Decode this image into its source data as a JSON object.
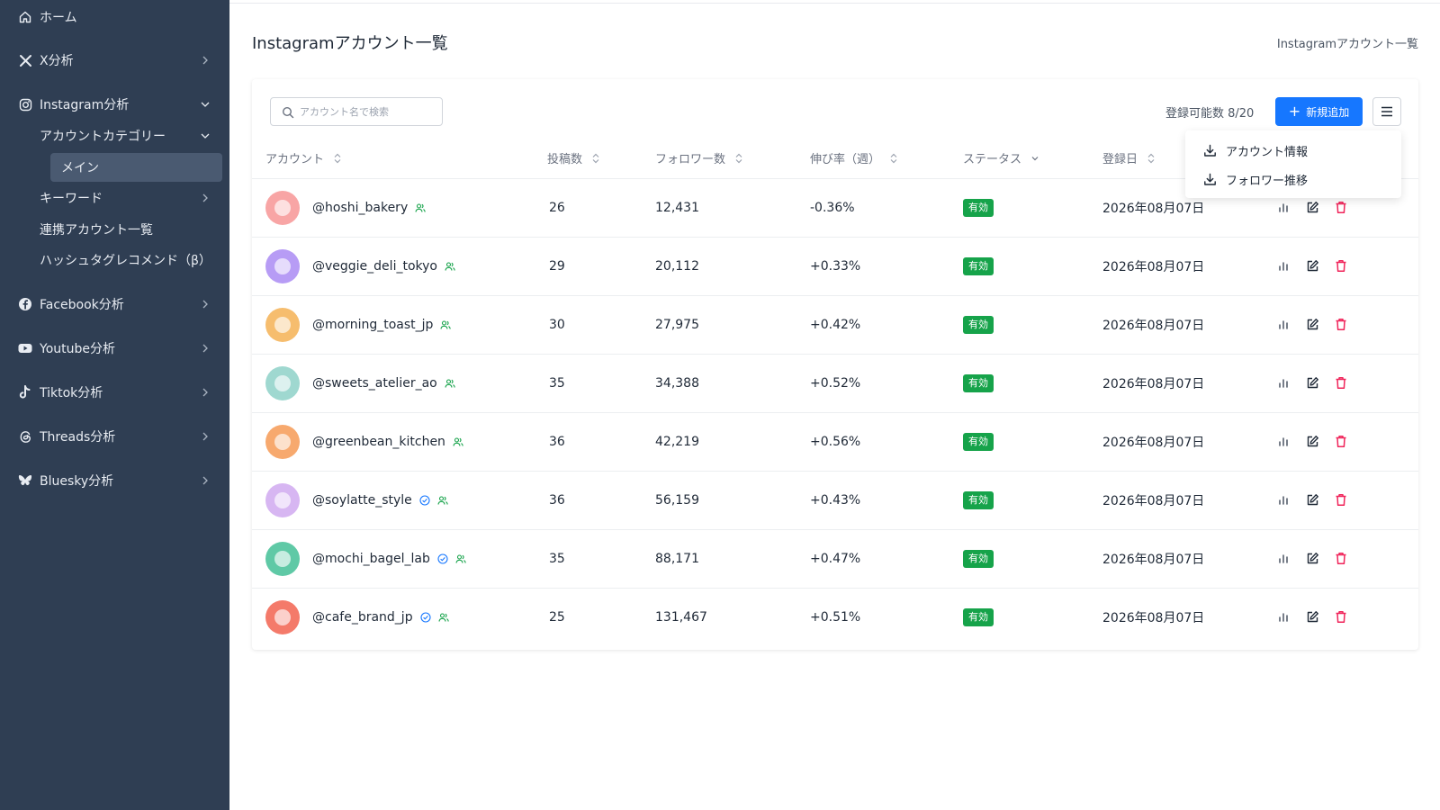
{
  "sidebar": {
    "items": [
      {
        "label": "ホーム",
        "icon": "home-icon"
      },
      {
        "label": "X分析",
        "icon": "x-logo-icon"
      },
      {
        "label": "Instagram分析",
        "icon": "instagram-icon"
      },
      {
        "label": "アカウントカテゴリー"
      },
      {
        "label": "メイン"
      },
      {
        "label": "キーワード"
      },
      {
        "label": "連携アカウント一覧"
      },
      {
        "label": "ハッシュタグレコメンド（β）"
      },
      {
        "label": "Facebook分析",
        "icon": "facebook-icon"
      },
      {
        "label": "Youtube分析",
        "icon": "youtube-icon"
      },
      {
        "label": "Tiktok分析",
        "icon": "tiktok-icon"
      },
      {
        "label": "Threads分析",
        "icon": "threads-icon"
      },
      {
        "label": "Bluesky分析",
        "icon": "bluesky-icon"
      }
    ]
  },
  "header": {
    "title": "Instagramアカウント一覧",
    "breadcrumb": "Instagramアカウント一覧"
  },
  "toolbar": {
    "search_placeholder": "アカウント名で検索",
    "quota": "登録可能数 8/20",
    "add_label": "新規追加"
  },
  "dropdown": {
    "items": [
      "アカウント情報",
      "フォロワー推移"
    ]
  },
  "table": {
    "columns": [
      "アカウント",
      "投稿数",
      "フォロワー数",
      "伸び率（週）",
      "ステータス",
      "登録日"
    ],
    "rows": [
      {
        "account": "@hoshi_bakery",
        "posts": "26",
        "followers": "12,431",
        "growth": "-0.36%",
        "status": "有効",
        "date": "2026年08月07日",
        "verified": false,
        "avatar_color": "#f8a5a5"
      },
      {
        "account": "@veggie_deli_tokyo",
        "posts": "29",
        "followers": "20,112",
        "growth": "+0.33%",
        "status": "有効",
        "date": "2026年08月07日",
        "verified": false,
        "avatar_color": "#b79cf5"
      },
      {
        "account": "@morning_toast_jp",
        "posts": "30",
        "followers": "27,975",
        "growth": "+0.42%",
        "status": "有効",
        "date": "2026年08月07日",
        "verified": false,
        "avatar_color": "#f6bd6e"
      },
      {
        "account": "@sweets_atelier_ao",
        "posts": "35",
        "followers": "34,388",
        "growth": "+0.52%",
        "status": "有効",
        "date": "2026年08月07日",
        "verified": false,
        "avatar_color": "#9fd8d0"
      },
      {
        "account": "@greenbean_kitchen",
        "posts": "36",
        "followers": "42,219",
        "growth": "+0.56%",
        "status": "有効",
        "date": "2026年08月07日",
        "verified": false,
        "avatar_color": "#f7a96e"
      },
      {
        "account": "@soylatte_style",
        "posts": "36",
        "followers": "56,159",
        "growth": "+0.43%",
        "status": "有効",
        "date": "2026年08月07日",
        "verified": true,
        "avatar_color": "#d7b6f2"
      },
      {
        "account": "@mochi_bagel_lab",
        "posts": "35",
        "followers": "88,171",
        "growth": "+0.47%",
        "status": "有効",
        "date": "2026年08月07日",
        "verified": true,
        "avatar_color": "#5fc9a6"
      },
      {
        "account": "@cafe_brand_jp",
        "posts": "25",
        "followers": "131,467",
        "growth": "+0.51%",
        "status": "有効",
        "date": "2026年08月07日",
        "verified": true,
        "avatar_color": "#f47a6a"
      }
    ]
  },
  "colors": {
    "sidebar_bg": "#2f3e53",
    "primary": "#1677ff",
    "status_green": "#16a34a",
    "negative": "#e0245e",
    "delete_red": "#f0245a"
  }
}
